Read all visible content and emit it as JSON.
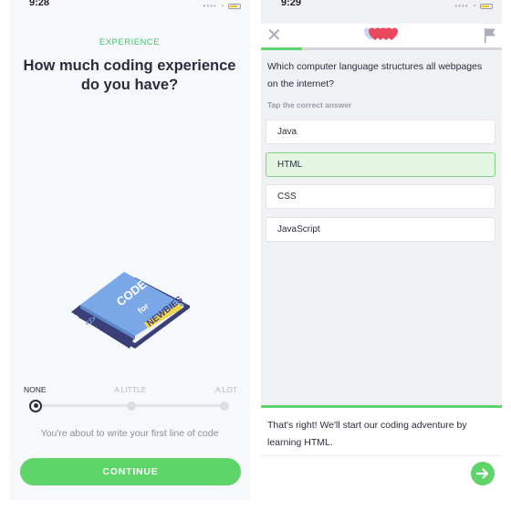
{
  "left": {
    "status_time": "9:28",
    "eyebrow": "EXPERIENCE",
    "question": "How much coding experience do you have?",
    "book": {
      "title_line1": "CODE",
      "title_line2": "for",
      "title_line3": "NEWBIES",
      "spine_symbol": "</>"
    },
    "scale": {
      "labels": [
        "NONE",
        "A LITTLE",
        "A LOT"
      ],
      "selected": "NONE"
    },
    "helper_text": "You're about to write your first line of code",
    "continue_label": "CONTINUE"
  },
  "right": {
    "status_time": "9:29",
    "hearts_count": 5,
    "progress_fraction": 0.17,
    "question": "Which computer language structures all webpages on the internet?",
    "instruction": "Tap the correct answer",
    "options": [
      "Java",
      "HTML",
      "CSS",
      "JavaScript"
    ],
    "correct_option": "HTML",
    "feedback": "That's right! We'll start our coding adventure by learning HTML."
  },
  "colors": {
    "accent_green": "#5fd46b",
    "eyebrow_green": "#3ec46d",
    "heart_red": "#e8475d",
    "book_blue": "#7aa7e8",
    "book_navy": "#3a3f77",
    "book_yellow": "#f5d54a"
  },
  "icons": [
    "close-icon",
    "heart-icon",
    "flag-icon",
    "arrow-right-icon",
    "wifi-icon",
    "battery-icon"
  ]
}
